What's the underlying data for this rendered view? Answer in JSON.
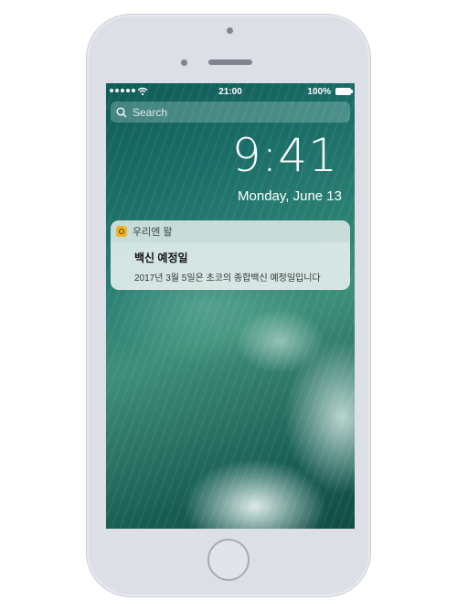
{
  "status_bar": {
    "time": "21:00",
    "battery_percent": "100%",
    "signal_icon": "signal-dots-icon",
    "wifi_icon": "wifi-icon",
    "battery_icon": "battery-icon"
  },
  "search": {
    "placeholder": "Search",
    "icon": "search-icon"
  },
  "lock_screen": {
    "time": "9:41",
    "date": "Monday, June 13"
  },
  "notification": {
    "app_name": "우리엔 왈",
    "title": "백신 예정일",
    "body": "2017년 3월 5일은 초코의 종합백신 예정일입니다",
    "app_icon_color": "#f2b21b"
  }
}
